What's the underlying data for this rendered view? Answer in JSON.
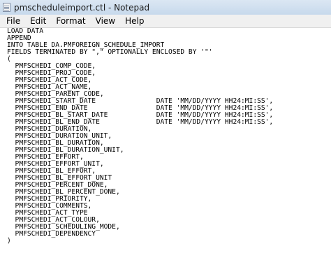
{
  "window": {
    "title": "pmscheduleimport.ctl - Notepad",
    "app_icon": "notepad-icon"
  },
  "menu": {
    "items": [
      "File",
      "Edit",
      "Format",
      "View",
      "Help"
    ]
  },
  "editor": {
    "lines": [
      "LOAD DATA",
      "APPEND",
      "INTO TABLE DA.PMFOREIGN_SCHEDULE_IMPORT",
      "FIELDS TERMINATED BY \",\" OPTIONALLY ENCLOSED BY '\"'",
      "(",
      "  PMFSCHEDI_COMP_CODE,",
      "  PMFSCHEDI_PROJ_CODE,",
      "  PMFSCHEDI_ACT_CODE,",
      "  PMFSCHEDI_ACT_NAME,",
      "  PMFSCHEDI_PARENT_CODE,",
      "  PMFSCHEDI_START_DATE               DATE 'MM/DD/YYYY HH24:MI:SS',",
      "  PMFSCHEDI_END_DATE                 DATE 'MM/DD/YYYY HH24:MI:SS',",
      "  PMFSCHEDI_BL_START_DATE            DATE 'MM/DD/YYYY HH24:MI:SS',",
      "  PMFSCHEDI_BL_END_DATE              DATE 'MM/DD/YYYY HH24:MI:SS',",
      "  PMFSCHEDI_DURATION,",
      "  PMFSCHEDI_DURATION_UNIT,",
      "  PMFSCHEDI_BL_DURATION,",
      "  PMFSCHEDI_BL_DURATION_UNIT,",
      "  PMFSCHEDI_EFFORT,",
      "  PMFSCHEDI_EFFORT_UNIT,",
      "  PMFSCHEDI_BL_EFFORT,",
      "  PMFSCHEDI_BL_EFFORT_UNIT",
      "  PMFSCHEDI_PERCENT_DONE,",
      "  PMFSCHEDI_BL_PERCENT_DONE,",
      "  PMFSCHEDI_PRIORITY,",
      "  PMFSCHEDI_COMMENTS,",
      "  PMFSCHEDI_ACT_TYPE",
      "  PMFSCHEDI_ACT_COLOUR,",
      "  PMFSCHEDI_SCHEDULING_MODE,",
      "  PMFSCHEDI_DEPENDENCY",
      ")"
    ]
  }
}
